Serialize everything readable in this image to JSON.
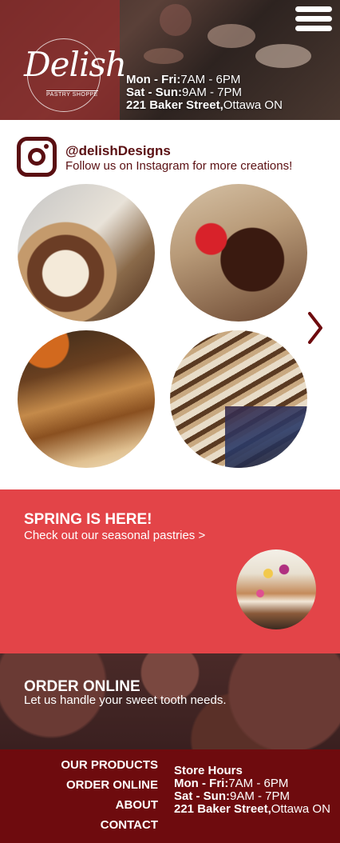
{
  "header": {
    "logo_text": "Delish",
    "logo_sub": "PASTRY SHOPPE",
    "hours": [
      {
        "label": "Mon - Fri:",
        "value": "7AM - 6PM"
      },
      {
        "label": "Sat - Sun:",
        "value": "9AM - 7PM"
      }
    ],
    "address": {
      "street": "221 Baker Street,",
      "city": "Ottawa ON"
    }
  },
  "instagram": {
    "handle": "@delishDesigns",
    "follow": "Follow us on Instagram for more creations!",
    "photos": [
      "chocolates-photo",
      "brownie-photo",
      "strudel-photo",
      "roll-cake-photo"
    ]
  },
  "spring": {
    "title": "SPRING IS HERE!",
    "link": "Check out our seasonal pastries >"
  },
  "order": {
    "title": "ORDER ONLINE",
    "subtitle": "Let us handle your sweet tooth needs."
  },
  "footer": {
    "nav": [
      "OUR PRODUCTS",
      "ORDER ONLINE",
      "ABOUT",
      "CONTACT"
    ],
    "store_hours_title": "Store Hours",
    "hours": [
      {
        "label": "Mon - Fri:",
        "value": "7AM - 6PM"
      },
      {
        "label": "Sat - Sun:",
        "value": "9AM - 7PM"
      }
    ],
    "address": {
      "street": "221 Baker Street,",
      "city": "Ottawa ON"
    }
  },
  "colors": {
    "maroon": "#6e0b0e",
    "brand_dark": "#5a0f12",
    "spring_red": "#e34448",
    "white": "#ffffff"
  },
  "icons": {
    "menu": "hamburger-icon",
    "instagram": "instagram-icon",
    "next": "chevron-right-icon"
  }
}
